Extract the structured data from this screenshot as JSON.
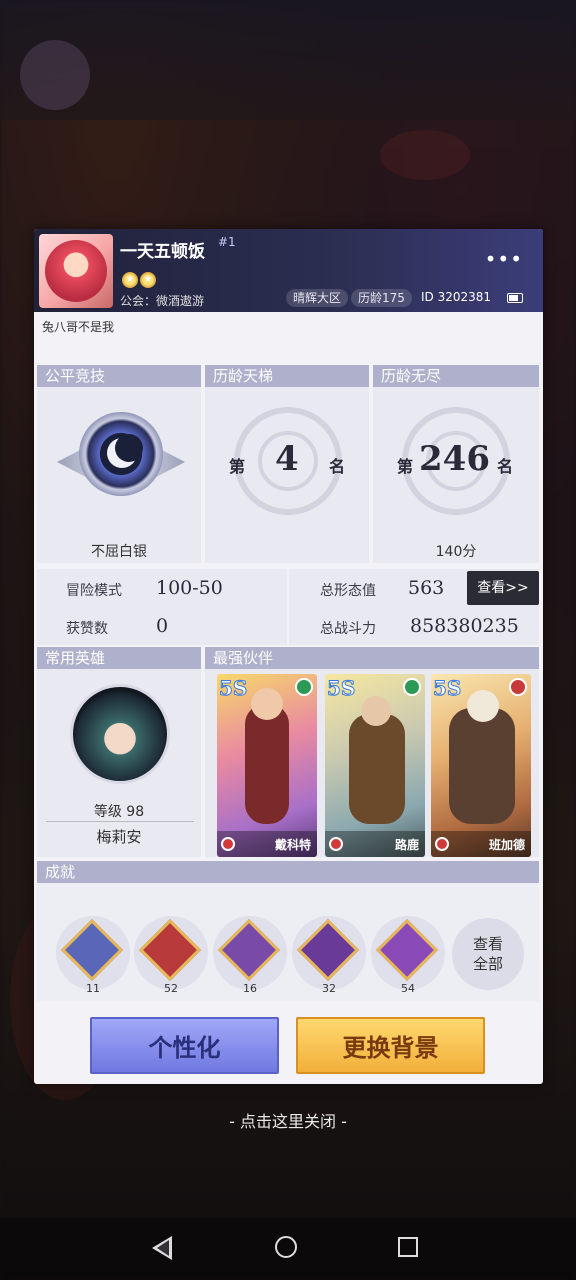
{
  "profile": {
    "name": "一天五顿饭",
    "rank_sup": "#1",
    "guild": "公会：微酒遨游",
    "server": "晴辉大区",
    "age": "历龄175",
    "id": "ID 3202381",
    "more": "•••",
    "motto": "兔八哥不是我"
  },
  "sections": {
    "fair": "公平竞技",
    "ladder": "历龄天梯",
    "endless": "历龄无尽",
    "hero": "常用英雄",
    "partner": "最强伙伴",
    "achievement": "成就"
  },
  "fair": {
    "tier": "不屈白银"
  },
  "ladder": {
    "prefix": "第",
    "rank": "4",
    "suffix": "名"
  },
  "endless": {
    "prefix": "第",
    "rank": "246",
    "suffix": "名",
    "score": "140分"
  },
  "stats": {
    "adventure_label": "冒险模式",
    "adventure_value": "100-50",
    "likes_label": "获赞数",
    "likes_value": "0",
    "form_label": "总形态值",
    "form_value": "563",
    "view_label": "查看>>",
    "power_label": "总战斗力",
    "power_value": "858380235"
  },
  "hero": {
    "level": "等级 98",
    "name": "梅莉安"
  },
  "partners": [
    {
      "grade": "5S",
      "name": "戴科特"
    },
    {
      "grade": "5S",
      "name": "路鹿"
    },
    {
      "grade": "5S",
      "name": "班加德"
    }
  ],
  "achievements": [
    {
      "count": "11"
    },
    {
      "count": "52"
    },
    {
      "count": "16"
    },
    {
      "count": "32"
    },
    {
      "count": "54"
    }
  ],
  "achievement_all": "查看全部",
  "buttons": {
    "personalize": "个性化",
    "change_bg": "更换背景"
  },
  "close_hint": "- 点击这里关闭 -"
}
